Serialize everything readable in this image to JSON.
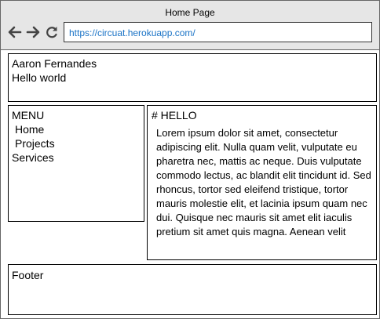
{
  "window": {
    "title": "Home Page"
  },
  "navigation": {
    "back_icon": "arrow-left-icon",
    "forward_icon": "arrow-right-icon",
    "reload_icon": "reload-icon",
    "url": "https://circuat.herokuapp.com/"
  },
  "header": {
    "name": "Aaron Fernandes",
    "greeting": "Hello world"
  },
  "menu": {
    "title": "MENU",
    "items": [
      "Home",
      "Projects",
      "Services"
    ]
  },
  "content": {
    "heading": "# HELLO",
    "body": "Lorem ipsum dolor sit amet, consectetur adipiscing elit. Nulla quam velit, vulputate eu pharetra nec, mattis ac neque. Duis vulputate commodo lectus, ac blandit elit tincidunt id. Sed rhoncus, tortor sed eleifend tristique, tortor mauris molestie elit, et lacinia ipsum quam nec dui. Quisque nec mauris sit amet elit iaculis pretium sit amet quis magna. Aenean velit"
  },
  "footer": {
    "label": "Footer"
  }
}
